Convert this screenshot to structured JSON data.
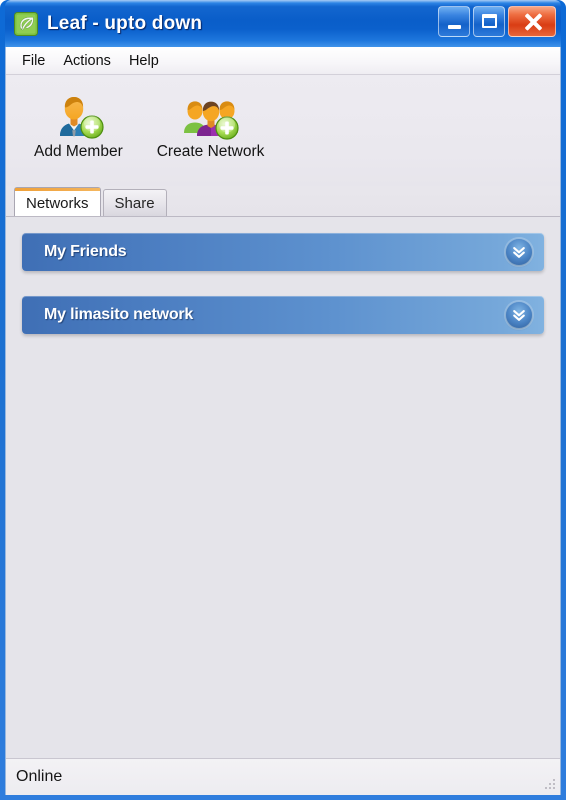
{
  "window": {
    "title": "Leaf - upto down",
    "icon": "leaf-icon",
    "controls": {
      "minimize": "Minimize",
      "maximize": "Maximize",
      "close": "Close"
    }
  },
  "menubar": {
    "items": [
      {
        "label": "File"
      },
      {
        "label": "Actions"
      },
      {
        "label": "Help"
      }
    ]
  },
  "toolbar": {
    "buttons": [
      {
        "label": "Add Member",
        "icon": "add-member-icon"
      },
      {
        "label": "Create Network",
        "icon": "create-network-icon"
      }
    ]
  },
  "tabs": [
    {
      "label": "Networks",
      "active": true
    },
    {
      "label": "Share",
      "active": false
    }
  ],
  "content": {
    "groups": [
      {
        "title": "My Friends",
        "expander": "double-chevron-down-icon",
        "expanded": false
      },
      {
        "title": "My limasito network",
        "expander": "double-chevron-down-icon",
        "expanded": false
      }
    ]
  },
  "statusbar": {
    "status": "Online"
  },
  "colors": {
    "title_blue": "#0a5ec9",
    "accent_orange": "#efa139",
    "group_blue": "#4a7cc0",
    "content_bg": "#e5e4ea",
    "close_red": "#d93d14"
  }
}
